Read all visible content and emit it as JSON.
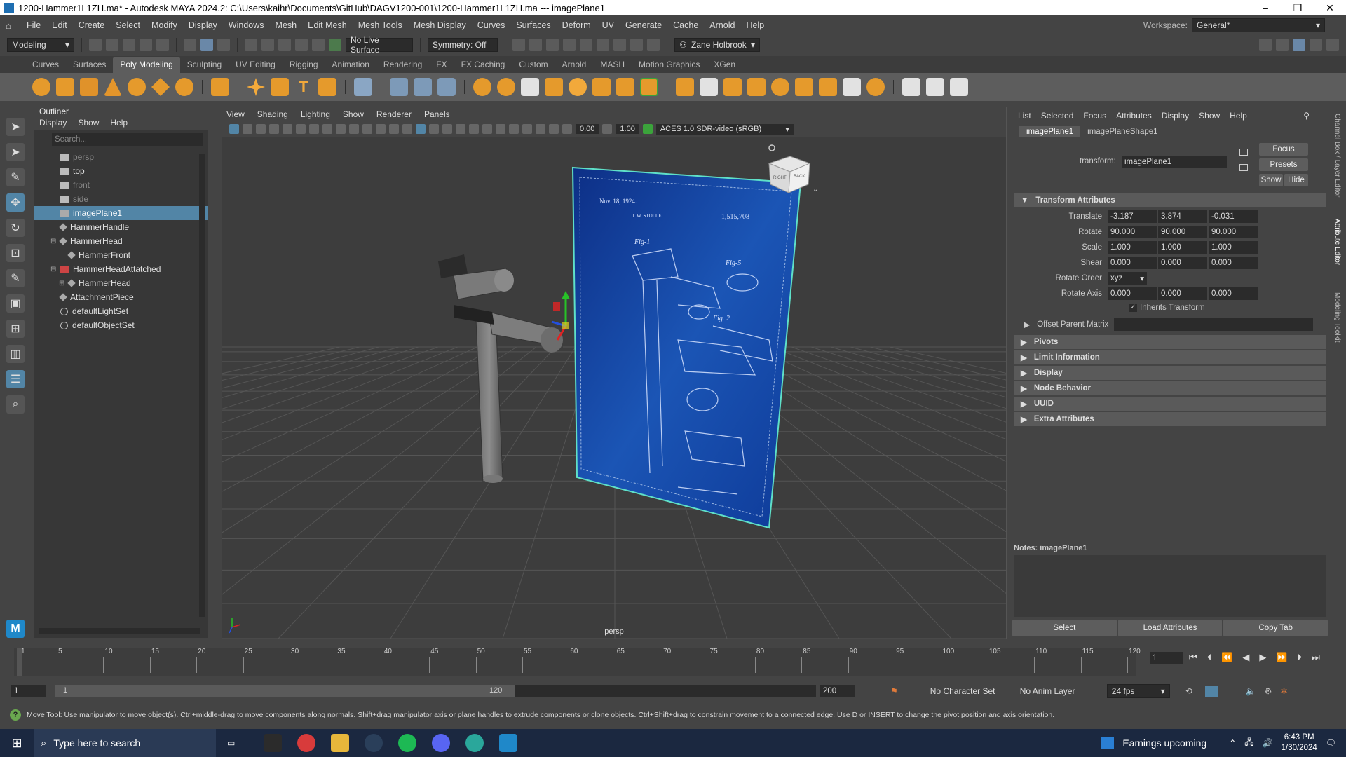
{
  "title_bar": {
    "title": "1200-Hammer1L1ZH.ma* - Autodesk MAYA 2024.2: C:\\Users\\kaihr\\Documents\\GitHub\\DAGV1200-001\\1200-Hammer1L1ZH.ma  ---  imagePlane1",
    "minimize": "–",
    "maximize": "❐",
    "close": "✕"
  },
  "menu_bar": {
    "items": [
      "File",
      "Edit",
      "Create",
      "Select",
      "Modify",
      "Display",
      "Windows",
      "Mesh",
      "Edit Mesh",
      "Mesh Tools",
      "Mesh Display",
      "Curves",
      "Surfaces",
      "Deform",
      "UV",
      "Generate",
      "Cache",
      "Arnold",
      "Help"
    ],
    "workspace_label": "Workspace:",
    "workspace_value": "General*"
  },
  "status_line": {
    "mode": "Modeling",
    "live_surface": "No Live Surface",
    "symmetry": "Symmetry: Off",
    "user": "Zane Holbrook"
  },
  "shelf_tabs": [
    "Curves",
    "Surfaces",
    "Poly Modeling",
    "Sculpting",
    "UV Editing",
    "Rigging",
    "Animation",
    "Rendering",
    "FX",
    "FX Caching",
    "Custom",
    "Arnold",
    "MASH",
    "Motion Graphics",
    "XGen"
  ],
  "shelf_active": "Poly Modeling",
  "outliner": {
    "title": "Outliner",
    "menu": [
      "Display",
      "Show",
      "Help"
    ],
    "search_placeholder": "Search...",
    "items": [
      {
        "label": "persp",
        "depth": 0,
        "dim": true,
        "icon": "camera-icon"
      },
      {
        "label": "top",
        "depth": 0,
        "dim": false,
        "icon": "camera-icon"
      },
      {
        "label": "front",
        "depth": 0,
        "dim": true,
        "icon": "camera-icon"
      },
      {
        "label": "side",
        "depth": 0,
        "dim": true,
        "icon": "camera-icon"
      },
      {
        "label": "imagePlane1",
        "depth": 0,
        "dim": false,
        "selected": true,
        "icon": "image-plane-icon"
      },
      {
        "label": "HammerHandle",
        "depth": 0,
        "dim": false,
        "icon": "transform-icon"
      },
      {
        "label": "HammerHead",
        "depth": 0,
        "dim": false,
        "expand": "⊟",
        "icon": "transform-icon"
      },
      {
        "label": "HammerFront",
        "depth": 1,
        "dim": false,
        "icon": "transform-icon"
      },
      {
        "label": "HammerHeadAttatched",
        "depth": 0,
        "dim": false,
        "expand": "⊟",
        "icon": "mesh-icon"
      },
      {
        "label": "HammerHead",
        "depth": 1,
        "dim": false,
        "expand": "⊞",
        "icon": "transform-icon"
      },
      {
        "label": "AttachmentPiece",
        "depth": 0,
        "dim": false,
        "icon": "transform-icon"
      },
      {
        "label": "defaultLightSet",
        "depth": 0,
        "dim": false,
        "icon": "set-icon"
      },
      {
        "label": "defaultObjectSet",
        "depth": 0,
        "dim": false,
        "icon": "set-icon"
      }
    ]
  },
  "viewport": {
    "menu": [
      "View",
      "Shading",
      "Lighting",
      "Show",
      "Renderer",
      "Panels"
    ],
    "near_value": "0.00",
    "gamma_value": "1.00",
    "color_space": "ACES 1.0 SDR-video (sRGB)",
    "camera_label": "persp",
    "view_cube": {
      "right": "RIGHT",
      "back": "BACK"
    },
    "blueprint": {
      "top_left": "Nov. 18, 1924.",
      "patent_no": "1,515,708",
      "inventor": "J. W. STOLLE",
      "fig1": "Fig-1",
      "fig5": "Fig-5",
      "fig2": "Fig. 2"
    }
  },
  "attribute_editor": {
    "menu": [
      "List",
      "Selected",
      "Focus",
      "Attributes",
      "Display",
      "Show",
      "Help"
    ],
    "tabs": [
      "imagePlane1",
      "imagePlaneShape1"
    ],
    "transform_label": "transform:",
    "transform_value": "imagePlane1",
    "buttons": {
      "focus": "Focus",
      "presets": "Presets",
      "show": "Show",
      "hide": "Hide"
    },
    "section_transform": "Transform Attributes",
    "rows": [
      {
        "label": "Translate",
        "values": [
          "-3.187",
          "3.874",
          "-0.031"
        ]
      },
      {
        "label": "Rotate",
        "values": [
          "90.000",
          "90.000",
          "90.000"
        ]
      },
      {
        "label": "Scale",
        "values": [
          "1.000",
          "1.000",
          "1.000"
        ]
      },
      {
        "label": "Shear",
        "values": [
          "0.000",
          "0.000",
          "0.000"
        ]
      }
    ],
    "rotate_order_label": "Rotate Order",
    "rotate_order_value": "xyz",
    "rotate_axis_label": "Rotate Axis",
    "rotate_axis_values": [
      "0.000",
      "0.000",
      "0.000"
    ],
    "inherits_transform": "Inherits Transform",
    "offset_parent_matrix": "Offset Parent Matrix",
    "sections": [
      "Pivots",
      "Limit Information",
      "Display",
      "Node Behavior",
      "UUID",
      "Extra Attributes"
    ],
    "notes_label": "Notes:  imagePlane1",
    "bottom_buttons": [
      "Select",
      "Load Attributes",
      "Copy Tab"
    ],
    "side_tabs": [
      "Channel Box / Layer Editor",
      "Attribute Editor",
      "Modeling Toolkit"
    ]
  },
  "timeline": {
    "ticks": [
      "1",
      "5",
      "10",
      "15",
      "20",
      "25",
      "30",
      "35",
      "40",
      "45",
      "50",
      "55",
      "60",
      "65",
      "70",
      "75",
      "80",
      "85",
      "90",
      "95",
      "100",
      "105",
      "110",
      "115",
      "120"
    ],
    "current_frame": "1"
  },
  "range": {
    "start": "1",
    "range_start": "1",
    "range_end_inner": "120",
    "end": "200",
    "character_set": "No Character Set",
    "anim_layer": "No Anim Layer",
    "fps": "24 fps"
  },
  "help_line": "Move Tool: Use manipulator to move object(s). Ctrl+middle-drag to move components along normals. Shift+drag manipulator axis or plane handles to extrude components or clone objects. Ctrl+Shift+drag to constrain movement to a connected edge. Use D or INSERT to change the pivot position and axis orientation.",
  "taskbar": {
    "search_placeholder": "Type here to search",
    "news": "Earnings upcoming",
    "time": "6:43 PM",
    "date": "1/30/2024"
  },
  "colors": {
    "accent": "#5285a6",
    "blueprint": "#1b4fa6",
    "bg": "#444444"
  }
}
